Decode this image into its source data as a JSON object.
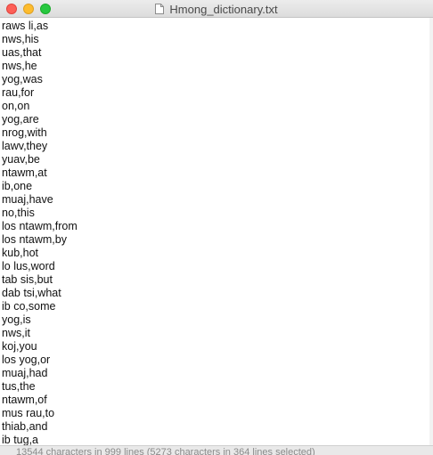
{
  "window": {
    "title": "Hmong_dictionary.txt",
    "icon": "text-document-icon"
  },
  "document": {
    "lines": [
      "raws li,as",
      "nws,his",
      "uas,that",
      "nws,he",
      "yog,was",
      "rau,for",
      "on,on",
      "yog,are",
      "nrog,with",
      "lawv,they",
      "yuav,be",
      "ntawm,at",
      "ib,one",
      "muaj,have",
      "no,this",
      "los ntawm,from",
      "los ntawm,by",
      "kub,hot",
      "lo lus,word",
      "tab sis,but",
      "dab tsi,what",
      "ib co,some",
      "yog,is",
      "nws,it",
      "koj,you",
      "los yog,or",
      "muaj,had",
      "tus,the",
      "ntawm,of",
      "mus rau,to",
      "thiab,and",
      "ib tug,a"
    ]
  },
  "status_bar": {
    "text": "13544 characters in 999 lines (5273 characters in 364 lines selected)"
  },
  "colors": {
    "close": "#fd5f57",
    "minimize": "#fdbc2e",
    "zoom": "#28c840"
  }
}
